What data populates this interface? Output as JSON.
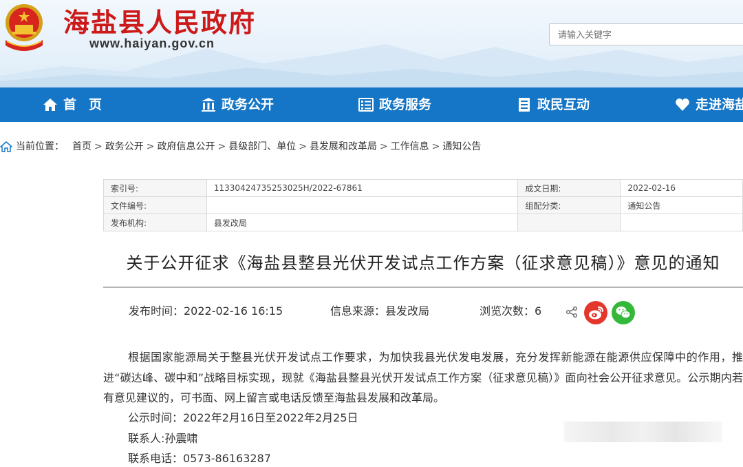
{
  "header": {
    "site_title": "海盐县人民政府",
    "site_url": "www.haiyan.gov.cn",
    "search_placeholder": "请输入关键字"
  },
  "nav": {
    "items": [
      {
        "label": "首页",
        "icon": "home-icon"
      },
      {
        "label": "政务公开",
        "icon": "building-icon"
      },
      {
        "label": "政务服务",
        "icon": "list-icon"
      },
      {
        "label": "政民互动",
        "icon": "document-icon"
      },
      {
        "label": "走进海盐",
        "icon": "heart-icon"
      }
    ]
  },
  "breadcrumb": {
    "label": "当前位置：",
    "items": [
      "首页",
      "政务公开",
      "政府信息公开",
      "县级部门、单位",
      "县发展和改革局",
      "工作信息",
      "通知公告"
    ]
  },
  "meta": {
    "index_no_label": "索引号:",
    "index_no": "11330424735253025H/2022-67861",
    "date_label": "成文日期:",
    "date": "2022-02-16",
    "file_no_label": "文件编号:",
    "file_no": "",
    "category_label": "组配分类:",
    "category": "通知公告",
    "publisher_label": "发布机构:",
    "publisher": "县发改局"
  },
  "article": {
    "title": "关于公开征求《海盐县整县光伏开发试点工作方案（征求意见稿）》意见的通知",
    "publish_time": "发布时间：2022-02-16 16:15",
    "source": "信息来源：县发改局",
    "views": "浏览次数：6",
    "body": "根据国家能源局关于整县光伏开发试点工作要求，为加快我县光伏发电发展，充分发挥新能源在能源供应保障中的作用，推进“碳达峰、碳中和”战略目标实现，现就《海盐县整县光伏开发试点工作方案（征求意见稿）》面向社会公开征求意见。公示期内若有意见建议的，可书面、网上留言或电话反馈至海盐县发展和改革局。",
    "period": "公示时间：2022年2月16日至2022年2月25日",
    "contact": "联系人:孙震啸",
    "phone": "联系电话：0573-86163287"
  },
  "colors": {
    "brand_red": "#cc1a1a",
    "nav_blue": "#1575c6",
    "weibo_red": "#e5362c",
    "wechat_green": "#34b83a"
  }
}
